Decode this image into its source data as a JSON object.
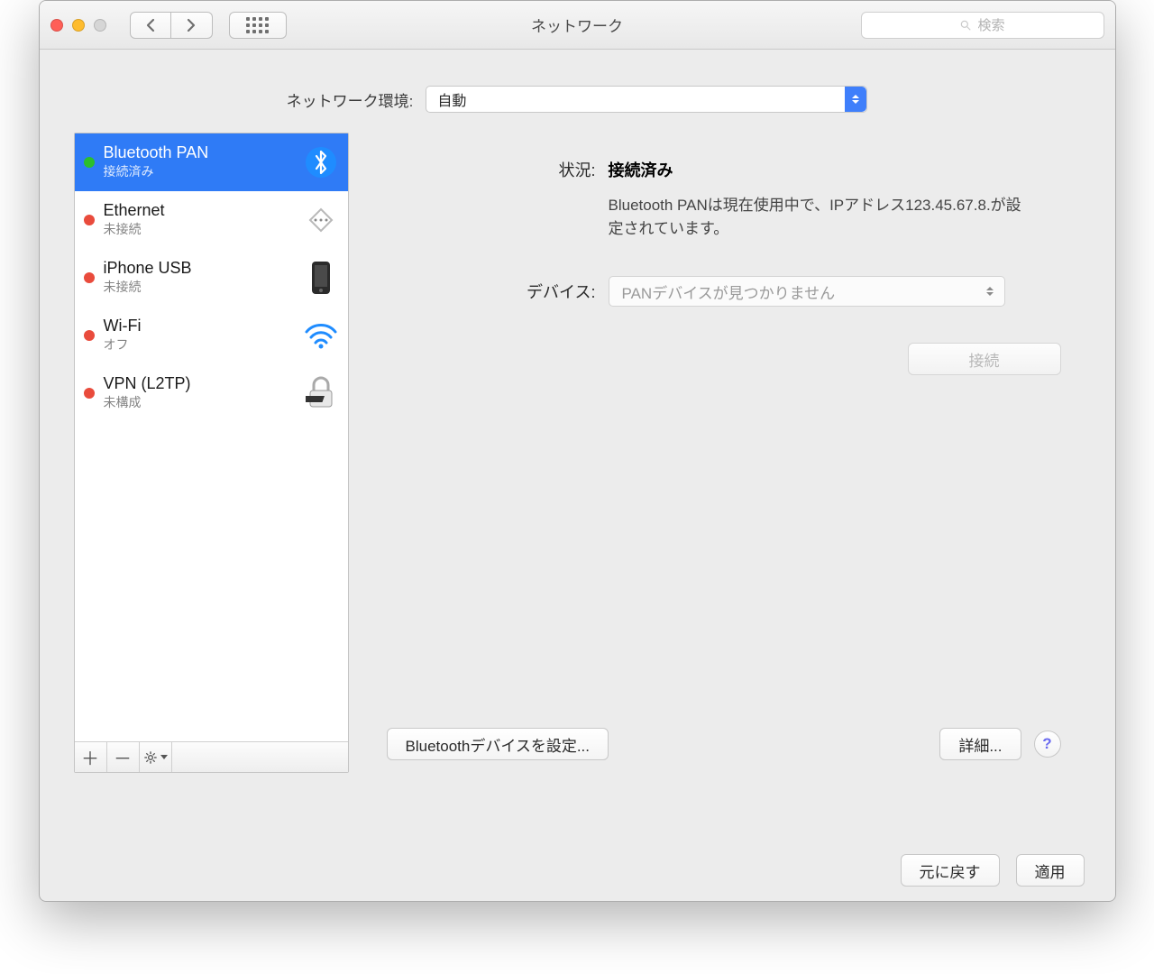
{
  "window": {
    "title": "ネットワーク",
    "search_placeholder": "検索"
  },
  "location": {
    "label": "ネットワーク環境:",
    "value": "自動"
  },
  "services": [
    {
      "name": "Bluetooth PAN",
      "status": "接続済み",
      "dot": "green",
      "icon": "bluetooth",
      "selected": true
    },
    {
      "name": "Ethernet",
      "status": "未接続",
      "dot": "red",
      "icon": "ethernet",
      "selected": false
    },
    {
      "name": "iPhone USB",
      "status": "未接続",
      "dot": "red",
      "icon": "iphone",
      "selected": false
    },
    {
      "name": "Wi-Fi",
      "status": "オフ",
      "dot": "red",
      "icon": "wifi",
      "selected": false
    },
    {
      "name": "VPN (L2TP)",
      "status": "未構成",
      "dot": "red",
      "icon": "vpn",
      "selected": false
    }
  ],
  "detail": {
    "status_label": "状況:",
    "status_value": "接続済み",
    "status_desc": "Bluetooth PANは現在使用中で、IPアドレス123.45.67.8.が設定されています。",
    "device_label": "デバイス:",
    "device_value": "PANデバイスが見つかりません",
    "connect_label": "接続",
    "config_bt_label": "Bluetoothデバイスを設定...",
    "advanced_label": "詳細..."
  },
  "footer": {
    "revert": "元に戻す",
    "apply": "適用"
  }
}
